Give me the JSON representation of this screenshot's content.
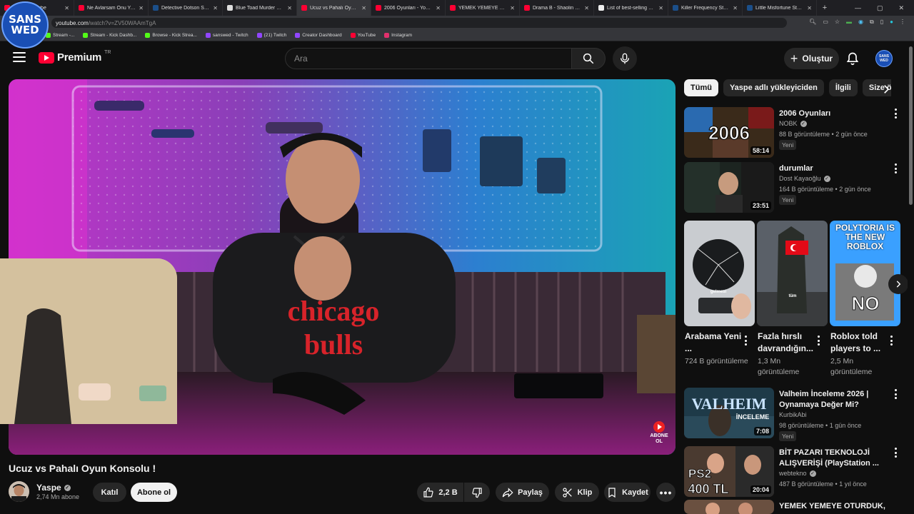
{
  "browser": {
    "tabs": [
      {
        "title": "oğlu - YouTube",
        "color": "#ff0033"
      },
      {
        "title": "Ne Avlarsam Onu Yedim",
        "color": "#ff0033"
      },
      {
        "title": "Detective Dotson Steam'de",
        "color": "#1b4f8a"
      },
      {
        "title": "Blue Toad Murder Mystery",
        "color": "#dddddd"
      },
      {
        "title": "Ucuz vs Pahalı Oyun K",
        "color": "#ff0033",
        "active": true
      },
      {
        "title": "2006 Oyunları - YouTube",
        "color": "#ff0033"
      },
      {
        "title": "YEMEK YEMEYE OTURDUK",
        "color": "#ff0033"
      },
      {
        "title": "Drama B - Shaolin Style (I",
        "color": "#ff0033"
      },
      {
        "title": "List of best-selling game",
        "color": "#eeeeee"
      },
      {
        "title": "Killer Frequency Steam'de",
        "color": "#1b4f8a"
      },
      {
        "title": "Little Misfortune Steam'de",
        "color": "#1b4f8a"
      }
    ],
    "new_tab": "+",
    "url_host": "youtube.com",
    "url_rest": "/watch?v=ZV50WAAmTgA",
    "bookmarks": [
      {
        "label": "Stream -...",
        "color": "#53fc18"
      },
      {
        "label": "Stream - Kick Dashb...",
        "color": "#53fc18"
      },
      {
        "label": "Browse - Kick Strea...",
        "color": "#53fc18"
      },
      {
        "label": "sanswed - Twitch",
        "color": "#9146ff"
      },
      {
        "label": "(21) Twitch",
        "color": "#9146ff"
      },
      {
        "label": "Creator Dashboard",
        "color": "#9146ff"
      },
      {
        "label": "YouTube",
        "color": "#ff0033"
      },
      {
        "label": "Instagram",
        "color": "#e1306c"
      }
    ]
  },
  "overlay_logo": {
    "line1": "SANS",
    "line2": "WED"
  },
  "header": {
    "logo_word": "Premium",
    "country": "TR",
    "search_placeholder": "Ara",
    "create_label": "Oluştur",
    "avatar_text": "SANS WED"
  },
  "video": {
    "title": "Ucuz vs Pahalı Oyun Konsolu !",
    "channel": "Yaspe",
    "subscribers": "2,74 Mn abone",
    "join_label": "Katıl",
    "subscribe_label": "Abone ol",
    "likes": "2,2 B",
    "share_label": "Paylaş",
    "clip_label": "Klip",
    "save_label": "Kaydet",
    "overlay_subscribe": "ABONE OL",
    "shirt_text_1": "chicago",
    "shirt_text_2": "bulls"
  },
  "chips": [
    {
      "label": "Tümü",
      "active": true
    },
    {
      "label": "Yaspe adlı yükleyiciden"
    },
    {
      "label": "İlgili"
    },
    {
      "label": "Size ö"
    }
  ],
  "recs_top": [
    {
      "title": "2006 Oyunları",
      "channel": "NOBK",
      "verified": true,
      "meta": "88 B görüntüleme • 2 gün önce",
      "badge": "Yeni",
      "duration": "58:14",
      "thumb_text": "2006"
    },
    {
      "title": "durumlar",
      "channel": "Dost Kayaoğlu",
      "verified": true,
      "meta": "164 B görüntüleme • 2 gün önce",
      "badge": "Yeni",
      "duration": "23:51"
    }
  ],
  "shorts": [
    {
      "title": "Arabama Yeni ...",
      "views": "724 B görüntüleme",
      "thumb_text": "gelmesi"
    },
    {
      "title": "Fazla hırslı davrandığın...",
      "views": "1,3 Mn görüntüleme",
      "thumb_text": "tüm"
    },
    {
      "title": "Roblox told players to ...",
      "views": "2,5 Mn görüntüleme",
      "thumb_text": "POLYTORIA IS THE NEW ROBLOX",
      "thumb_text_2": "NO"
    }
  ],
  "recs_bottom": [
    {
      "title": "Valheim İnceleme 2026 | Oynamaya Değer Mi?",
      "channel": "KurbikAbi",
      "verified": false,
      "meta": "98 görüntüleme • 1 gün önce",
      "badge": "Yeni",
      "duration": "7:08",
      "thumb_text": "VALHEIM",
      "thumb_text_2": "İNCELEME"
    },
    {
      "title": "BİT PAZARI TEKNOLOJİ ALIŞVERİŞİ (PlayStation ...",
      "channel": "webtekno",
      "verified": true,
      "meta": "487 B görüntüleme • 1 yıl önce",
      "duration": "20:04",
      "thumb_text": "PS2",
      "thumb_text_2": "400 TL"
    },
    {
      "title": "YEMEK YEMEYE OTURDUK,",
      "channel": "",
      "verified": false,
      "meta": ""
    }
  ]
}
